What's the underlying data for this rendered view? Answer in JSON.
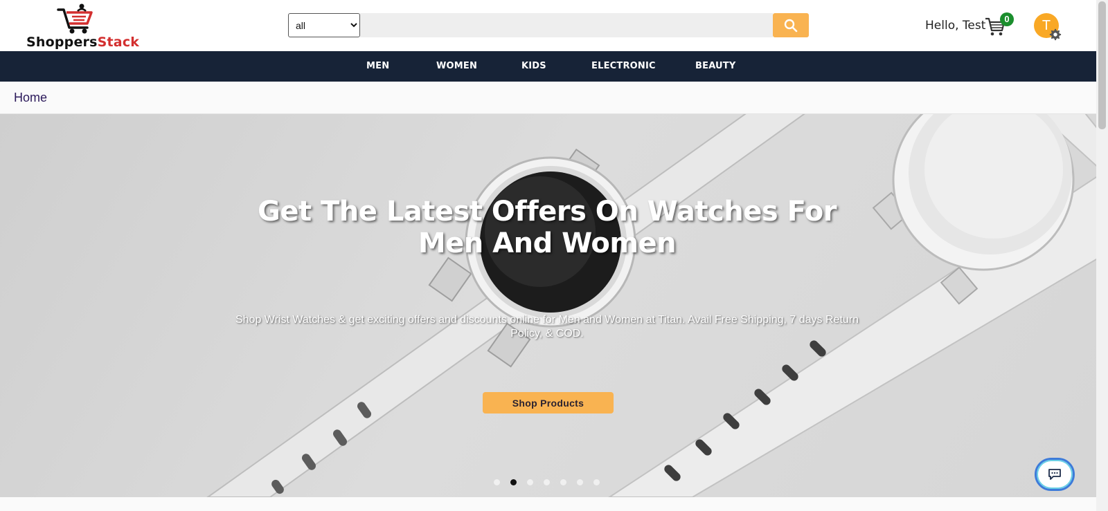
{
  "header": {
    "logo": {
      "part1": "Shoppers",
      "part2": "Stack"
    },
    "search": {
      "category_selected": "all",
      "category_options": [
        "all"
      ],
      "placeholder": "",
      "value": "",
      "button_icon": "search-icon"
    },
    "greeting": "Hello, Test",
    "cart": {
      "icon": "shopping-cart-icon",
      "count": "0"
    },
    "avatar": {
      "initial": "T",
      "icon": "gear-icon"
    }
  },
  "nav": {
    "items": [
      {
        "label": "MEN"
      },
      {
        "label": "WOMEN"
      },
      {
        "label": "KIDS"
      },
      {
        "label": "ELECTRONIC"
      },
      {
        "label": "BEAUTY"
      }
    ]
  },
  "breadcrumb": {
    "label": "Home"
  },
  "hero": {
    "title": "Get The Latest Offers On Watches For Men And Women",
    "subtitle": "Shop Wrist Watches & get exciting offers and discounts online for Men and Women at Titan. Avail Free Shipping, 7 days Return Policy, & COD.",
    "button_label": "Shop Products",
    "slide_count": 7,
    "active_slide": 2
  },
  "chat": {
    "icon": "chat-icon"
  },
  "colors": {
    "accent": "#f9b351",
    "nav_bg": "#172337",
    "cart_badge": "#1b8e2d",
    "avatar": "#f9a825",
    "logo_red": "#d32f2f"
  }
}
